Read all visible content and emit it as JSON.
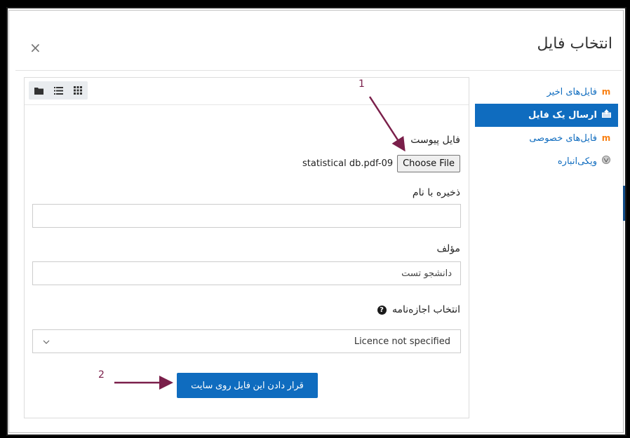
{
  "dialog": {
    "title": "انتخاب فایل",
    "close_label": "×"
  },
  "sidebar": {
    "items": [
      {
        "label": "فایل‌های اخیر",
        "icon": "moodle-icon",
        "active": false
      },
      {
        "label": "ارسال یک فایل",
        "icon": "upload-icon",
        "active": true
      },
      {
        "label": "فایل‌های خصوصی",
        "icon": "moodle-icon",
        "active": false
      },
      {
        "label": "ویکی‌انباره",
        "icon": "wikimedia-icon",
        "active": false
      }
    ]
  },
  "toolbar": {
    "views": [
      "folder-view-icon",
      "list-view-icon",
      "grid-view-icon"
    ]
  },
  "form": {
    "attachment_label": "فایل پیوست",
    "choose_file_label": "Choose File",
    "chosen_file_name": "statistical db.pdf-09",
    "save_as_label": "ذخیره با نام",
    "save_as_value": "",
    "author_label": "مؤلف",
    "author_value": "دانشجو تست",
    "license_label": "انتخاب اجازه‌نامه",
    "license_value": "Licence not specified",
    "submit_label": "قرار دادن این فایل روی سایت"
  },
  "annotations": {
    "label_1": "1",
    "label_2": "2",
    "arrow_color": "#7a1f4a"
  },
  "colors": {
    "brand_blue": "#0f6cbf",
    "moodle_orange": "#f98012"
  }
}
